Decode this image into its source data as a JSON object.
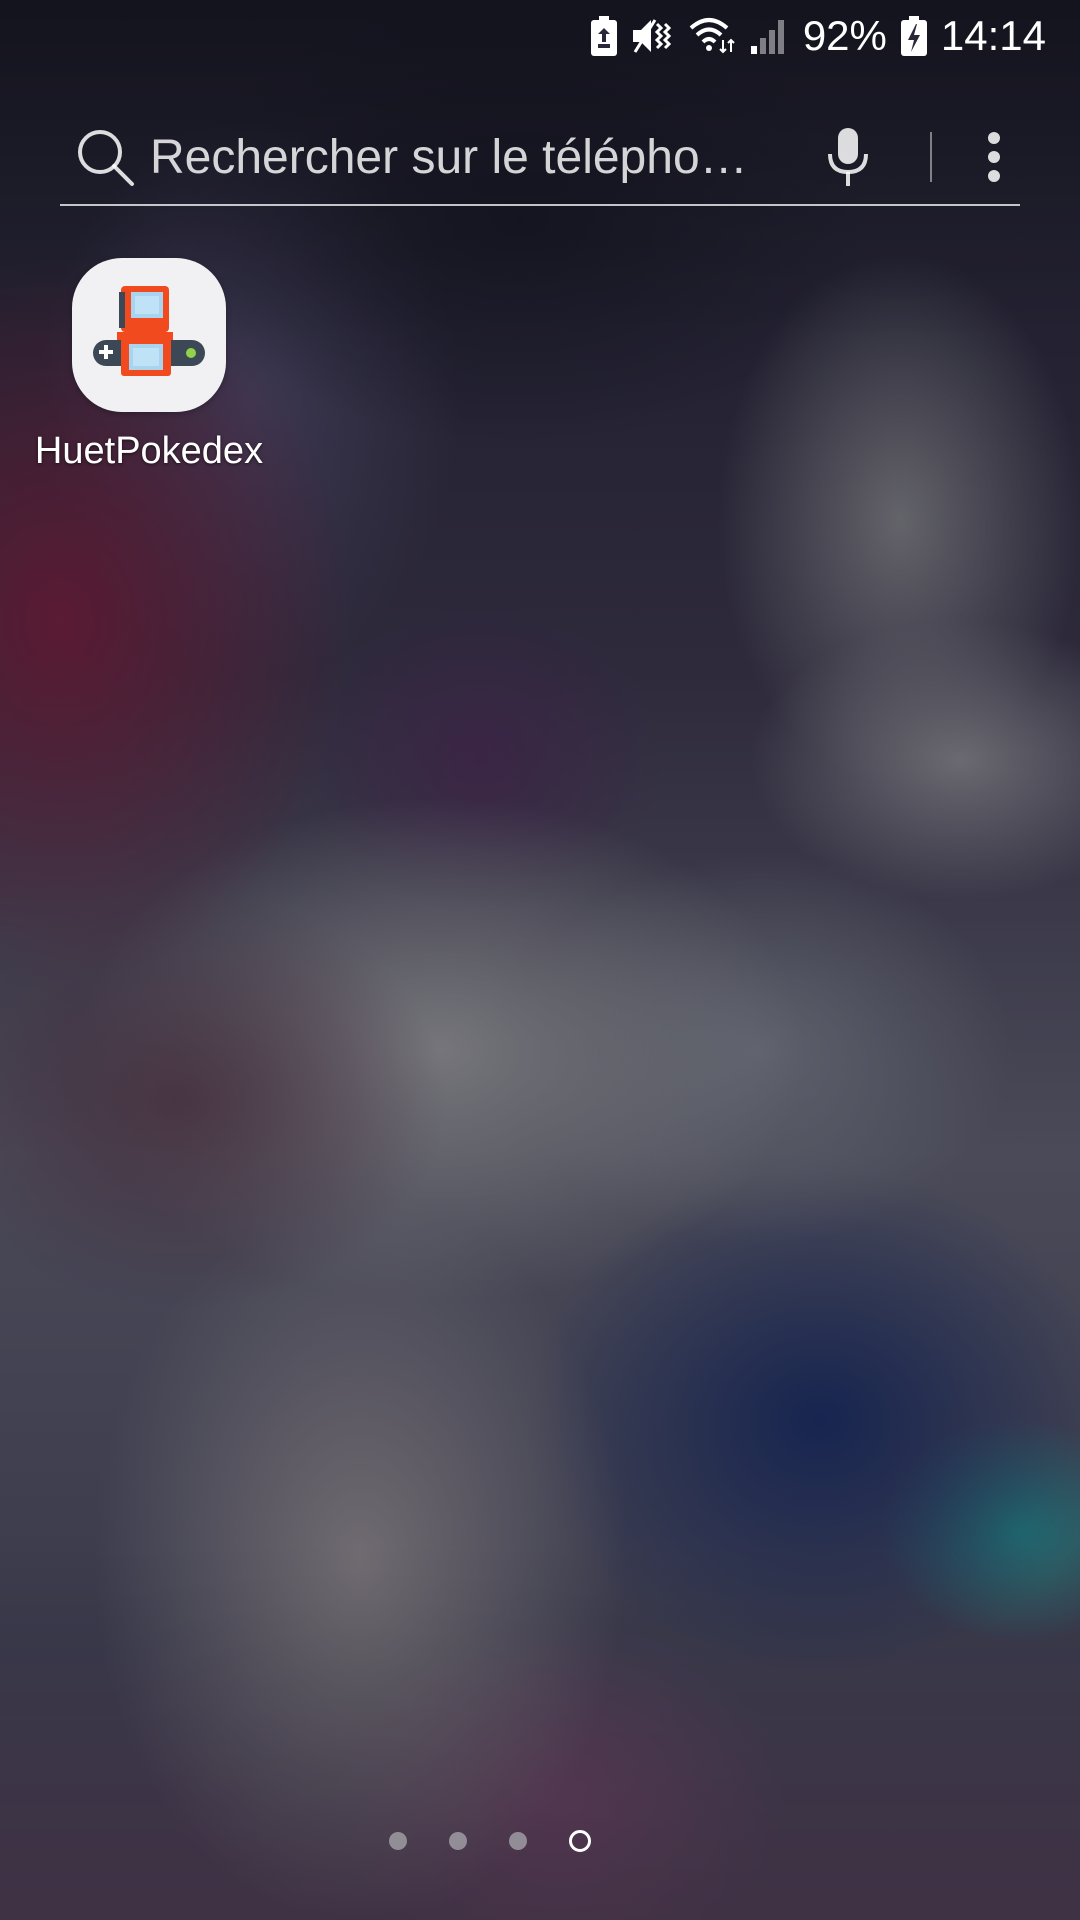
{
  "status_bar": {
    "battery_percent": "92%",
    "time": "14:14",
    "icons": [
      "battery-saver-icon",
      "vibrate-icon",
      "wifi-icon",
      "signal-icon",
      "battery-charging-icon"
    ]
  },
  "search": {
    "placeholder": "Rechercher sur le télépho…",
    "icons": [
      "search-icon",
      "mic-icon",
      "more-options-icon"
    ]
  },
  "apps": [
    {
      "label": "HuetPokedex",
      "icon": "game-console-icon"
    }
  ],
  "page_indicator": {
    "pages": 4,
    "current_page": 4
  }
}
